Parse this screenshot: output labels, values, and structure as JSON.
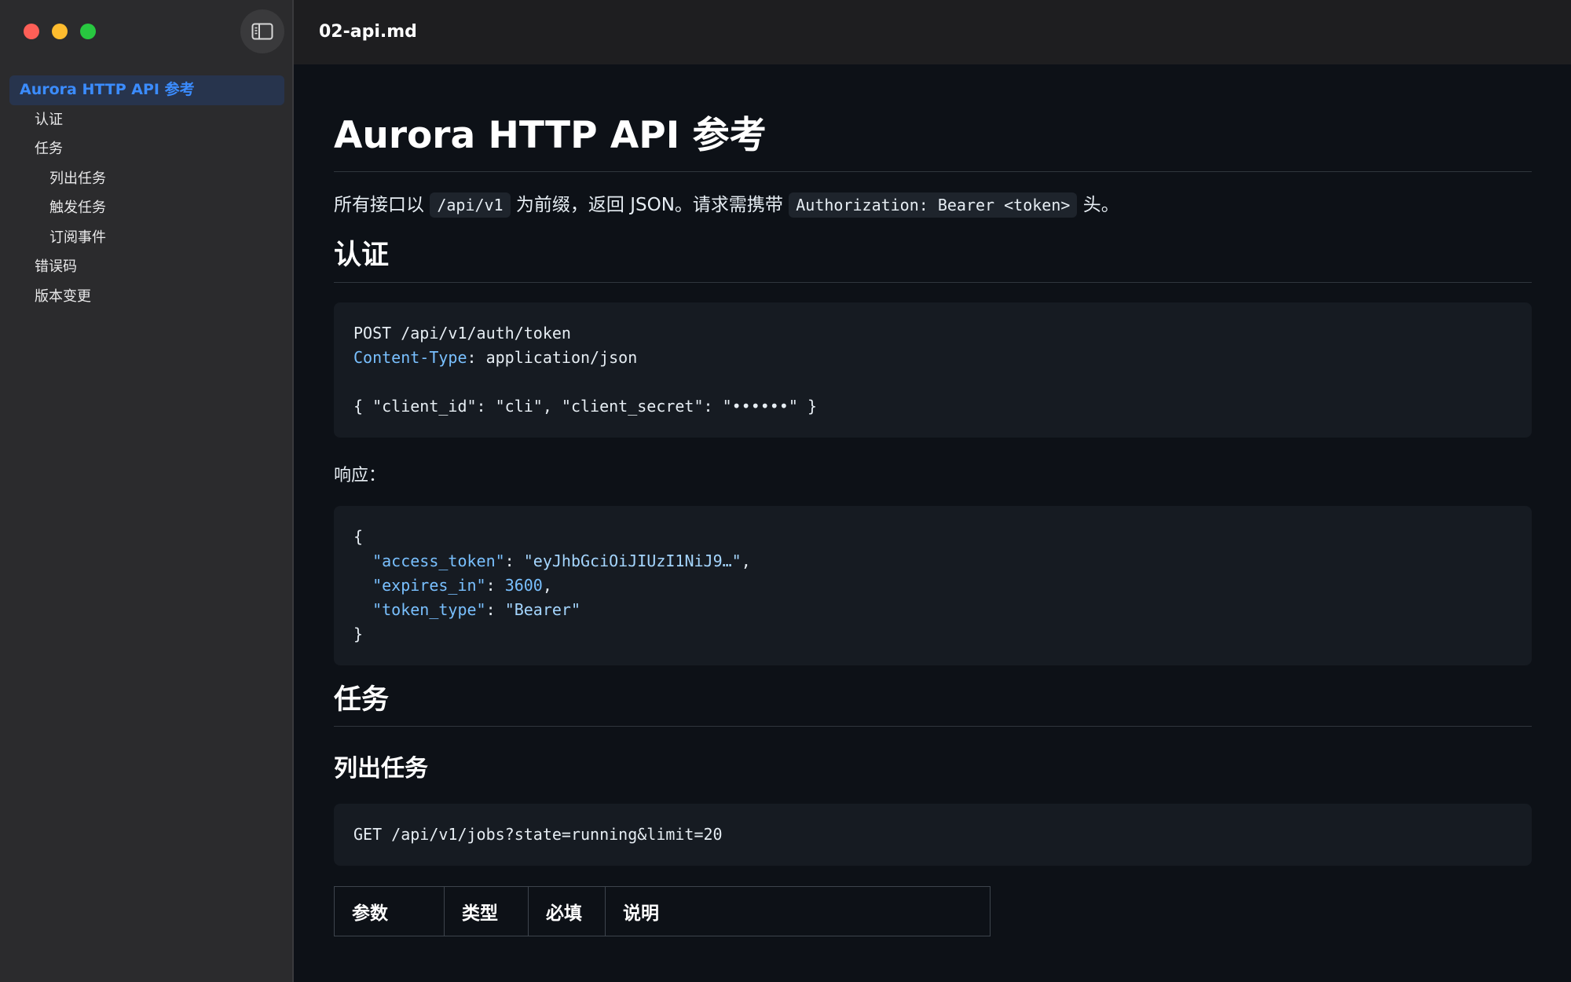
{
  "window": {
    "title": "02-api.md"
  },
  "sidebar": {
    "toc": [
      {
        "label": "Aurora HTTP API 参考",
        "level": 1,
        "active": true
      },
      {
        "label": "认证",
        "level": 2
      },
      {
        "label": "任务",
        "level": 2
      },
      {
        "label": "列出任务",
        "level": 3
      },
      {
        "label": "触发任务",
        "level": 3
      },
      {
        "label": "订阅事件",
        "level": 3
      },
      {
        "label": "错误码",
        "level": 2
      },
      {
        "label": "版本变更",
        "level": 2
      }
    ]
  },
  "doc": {
    "h1": "Aurora HTTP API 参考",
    "intro": {
      "t1": "所有接口以 ",
      "c1": "/api/v1",
      "t2": " 为前缀，返回 JSON。请求需携带 ",
      "c2": "Authorization: Bearer <token>",
      "t3": " 头。"
    },
    "auth": {
      "heading": "认证",
      "request": {
        "line1": "POST /api/v1/auth/token",
        "header_key": "Content-Type",
        "header_value": ": application/json",
        "body": "{ \"client_id\": \"cli\", \"client_secret\": \"••••••\" }"
      },
      "response_label": "响应：",
      "response": {
        "open": "{",
        "k1": "\"access_token\"",
        "v1": "\"eyJhbGciOiJIUzI1NiJ9…\"",
        "k2": "\"expires_in\"",
        "v2": "3600",
        "k3": "\"token_type\"",
        "v3": "\"Bearer\"",
        "close": "}"
      }
    },
    "jobs": {
      "heading": "任务",
      "list": {
        "heading": "列出任务",
        "request": "GET /api/v1/jobs?state=running&limit=20",
        "table_headers": [
          "参数",
          "类型",
          "必填",
          "说明"
        ]
      }
    }
  },
  "colors": {
    "accent": "#3b8cff",
    "code_key": "#79c0ff",
    "background": "#0d1117"
  }
}
